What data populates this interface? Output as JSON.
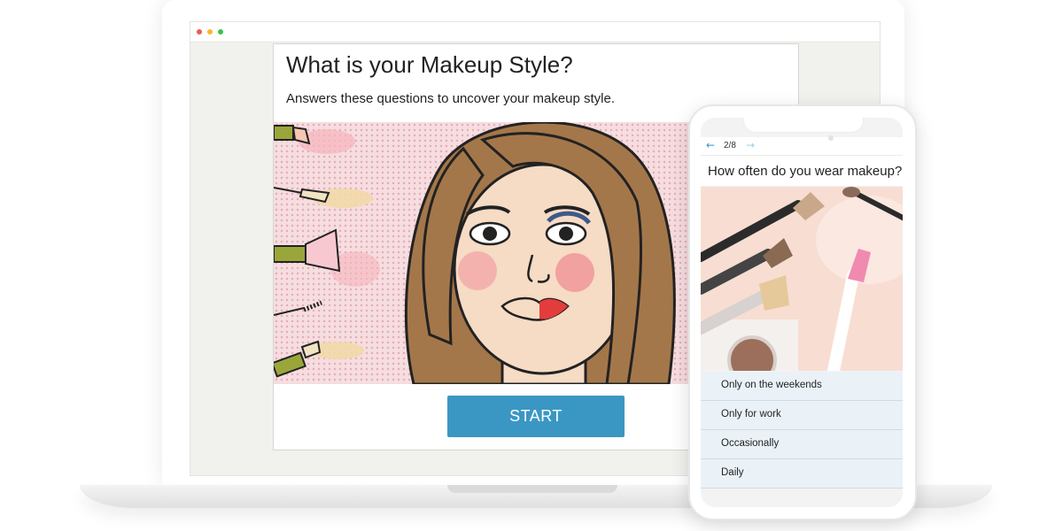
{
  "colors": {
    "accent": "#3a97c4",
    "option_background": "#eaf2f8",
    "window_close": "#f15a4a",
    "window_minimize": "#f6b92d",
    "window_zoom": "#35c548"
  },
  "desktop_quiz": {
    "title": "What is your Makeup Style?",
    "subtitle": "Answers these questions to uncover your makeup style.",
    "start_label": "START"
  },
  "mobile_quiz": {
    "back_icon": "arrow-left-icon",
    "progress": "2/8",
    "forward_icon": "arrow-right-icon",
    "question": "How often do you wear makeup?",
    "options": [
      "Only on the weekends",
      "Only for work",
      "Occasionally",
      "Daily"
    ]
  }
}
